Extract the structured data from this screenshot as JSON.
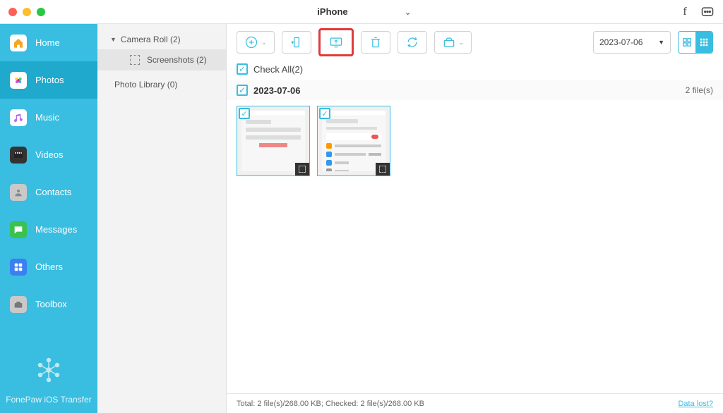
{
  "titlebar": {
    "device": "iPhone"
  },
  "sidebar": {
    "items": [
      {
        "label": "Home"
      },
      {
        "label": "Photos"
      },
      {
        "label": "Music"
      },
      {
        "label": "Videos"
      },
      {
        "label": "Contacts"
      },
      {
        "label": "Messages"
      },
      {
        "label": "Others"
      },
      {
        "label": "Toolbox"
      }
    ],
    "app_name": "FonePaw iOS Transfer"
  },
  "subpanel": {
    "camera_roll": "Camera Roll (2)",
    "screenshots": "Screenshots (2)",
    "photo_library": "Photo Library (0)"
  },
  "toolbar": {
    "date": "2023-07-06"
  },
  "checkall": "Check All(2)",
  "group": {
    "date": "2023-07-06",
    "count": "2 file(s)"
  },
  "status": {
    "text": "Total: 2 file(s)/268.00 KB; Checked: 2 file(s)/268.00 KB",
    "link": "Data lost?"
  }
}
